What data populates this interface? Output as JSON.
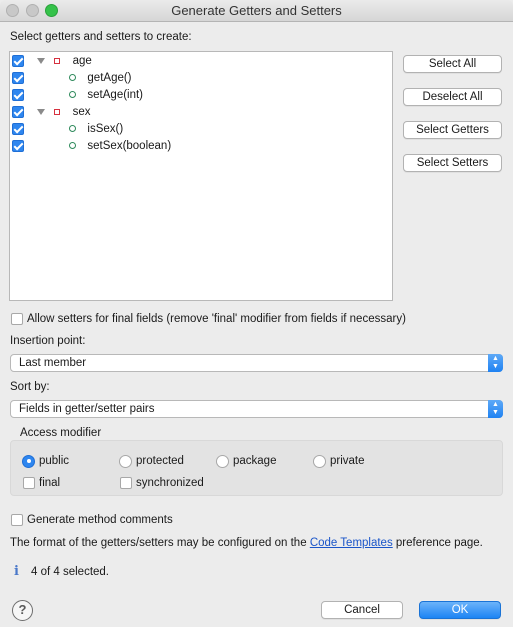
{
  "window": {
    "title": "Generate Getters and Setters"
  },
  "tree": {
    "label": "Select getters and setters to create:",
    "rows": [
      {
        "label": "age",
        "kind": "field",
        "checked": true
      },
      {
        "label": "getAge()",
        "kind": "method",
        "checked": true
      },
      {
        "label": "setAge(int)",
        "kind": "method",
        "checked": true
      },
      {
        "label": "sex",
        "kind": "field",
        "checked": true
      },
      {
        "label": "isSex()",
        "kind": "method",
        "checked": true
      },
      {
        "label": "setSex(boolean)",
        "kind": "method",
        "checked": true
      }
    ]
  },
  "buttons": {
    "select_all": "Select All",
    "deselect_all": "Deselect All",
    "select_getters": "Select Getters",
    "select_setters": "Select Setters",
    "cancel": "Cancel",
    "ok": "OK"
  },
  "options": {
    "allow_final_setters": "Allow setters for final fields (remove 'final' modifier from fields if necessary)",
    "generate_comments": "Generate method comments"
  },
  "insertion": {
    "label": "Insertion point:",
    "value": "Last member"
  },
  "sort": {
    "label": "Sort by:",
    "value": "Fields in getter/setter pairs"
  },
  "access": {
    "label": "Access modifier",
    "public": "public",
    "protected": "protected",
    "package": "package",
    "private": "private",
    "final": "final",
    "synchronized": "synchronized",
    "selected": "public"
  },
  "footer": {
    "info_prefix": "The format of the getters/setters may be configured on the ",
    "link": "Code Templates",
    "info_suffix": " preference page.",
    "status": "4 of 4 selected."
  },
  "colors": {
    "accent": "#2e86ef",
    "field_icon": "#d6313f",
    "method_icon": "#2f8a5c",
    "link": "#1a55c9"
  }
}
